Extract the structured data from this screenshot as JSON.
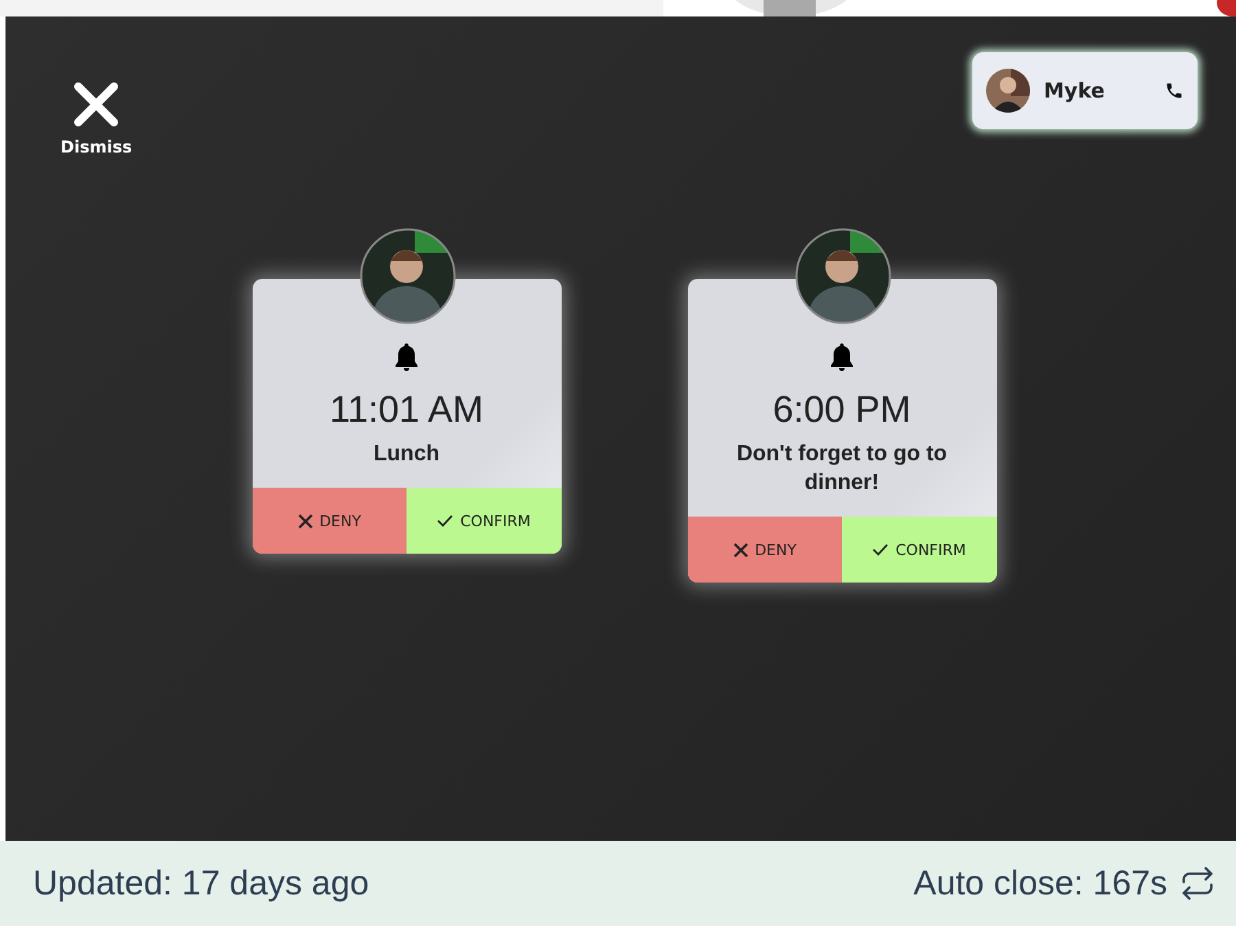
{
  "dismiss": {
    "label": "Dismiss"
  },
  "contact": {
    "name": "Myke"
  },
  "reminders": [
    {
      "time": "11:01 AM",
      "message": "Lunch",
      "deny": "DENY",
      "confirm": "CONFIRM"
    },
    {
      "time": "6:00 PM",
      "message": "Don't forget to go to dinner!",
      "deny": "DENY",
      "confirm": "CONFIRM"
    }
  ],
  "footer": {
    "updated": "Updated: 17 days ago",
    "auto_close": "Auto close: 167s"
  }
}
